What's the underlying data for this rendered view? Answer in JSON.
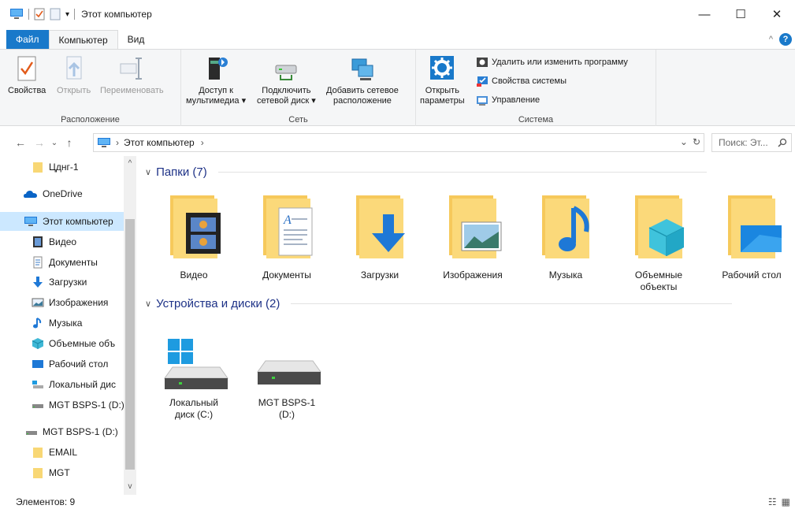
{
  "window": {
    "title": "Этот компьютер",
    "controls": {
      "minimize": "—",
      "maximize": "☐",
      "close": "✕"
    }
  },
  "ribbon_tabs": [
    "Файл",
    "Компьютер",
    "Вид"
  ],
  "ribbon": {
    "location": {
      "label": "Расположение",
      "properties": "Свойства",
      "open": "Открыть",
      "rename": "Переименовать"
    },
    "network": {
      "label": "Сеть",
      "media_l1": "Доступ к",
      "media_l2": "мультимедиа",
      "map_l1": "Подключить",
      "map_l2": "сетевой диск",
      "addloc_l1": "Добавить сетевое",
      "addloc_l2": "расположение"
    },
    "system": {
      "label": "Система",
      "settings_l1": "Открыть",
      "settings_l2": "параметры",
      "uninstall": "Удалить или изменить программу",
      "sysprops": "Свойства системы",
      "manage": "Управление"
    }
  },
  "address": {
    "crumb": "Этот компьютер",
    "separator": "›",
    "search_placeholder": "Поиск: Эт..."
  },
  "sidebar": {
    "items": [
      {
        "label": "Цднг-1",
        "icon": "folder-icon"
      },
      {
        "label": "OneDrive",
        "icon": "onedrive-icon"
      },
      {
        "label": "Этот компьютер",
        "icon": "computer-icon"
      },
      {
        "label": "Видео",
        "icon": "video-icon"
      },
      {
        "label": "Документы",
        "icon": "documents-icon"
      },
      {
        "label": "Загрузки",
        "icon": "downloads-icon"
      },
      {
        "label": "Изображения",
        "icon": "pictures-icon"
      },
      {
        "label": "Музыка",
        "icon": "music-icon"
      },
      {
        "label": "Объемные объ",
        "icon": "3d-objects-icon"
      },
      {
        "label": "Рабочий стол",
        "icon": "desktop-icon"
      },
      {
        "label": "Локальный дис",
        "icon": "local-disk-icon"
      },
      {
        "label": "MGT BSPS-1 (D:)",
        "icon": "usb-drive-icon"
      },
      {
        "label": "MGT BSPS-1 (D:)",
        "icon": "usb-drive-icon"
      },
      {
        "label": "EMAIL",
        "icon": "folder-icon"
      },
      {
        "label": "MGT",
        "icon": "folder-icon"
      }
    ]
  },
  "sections": {
    "folders": "Папки (7)",
    "devices": "Устройства и диски (2)"
  },
  "folders": [
    {
      "label": "Видео"
    },
    {
      "label": "Документы"
    },
    {
      "label": "Загрузки"
    },
    {
      "label": "Изображения"
    },
    {
      "label": "Музыка"
    },
    {
      "label_l1": "Объемные",
      "label_l2": "объекты"
    },
    {
      "label": "Рабочий стол"
    }
  ],
  "drives": [
    {
      "label_l1": "Локальный",
      "label_l2": "диск (C:)"
    },
    {
      "label_l1": "MGT BSPS-1",
      "label_l2": "(D:)"
    }
  ],
  "status": {
    "count": "Элементов: 9"
  },
  "colors": {
    "accent": "#1979ca",
    "selected": "#cce8ff",
    "section_text": "#1e3287"
  }
}
